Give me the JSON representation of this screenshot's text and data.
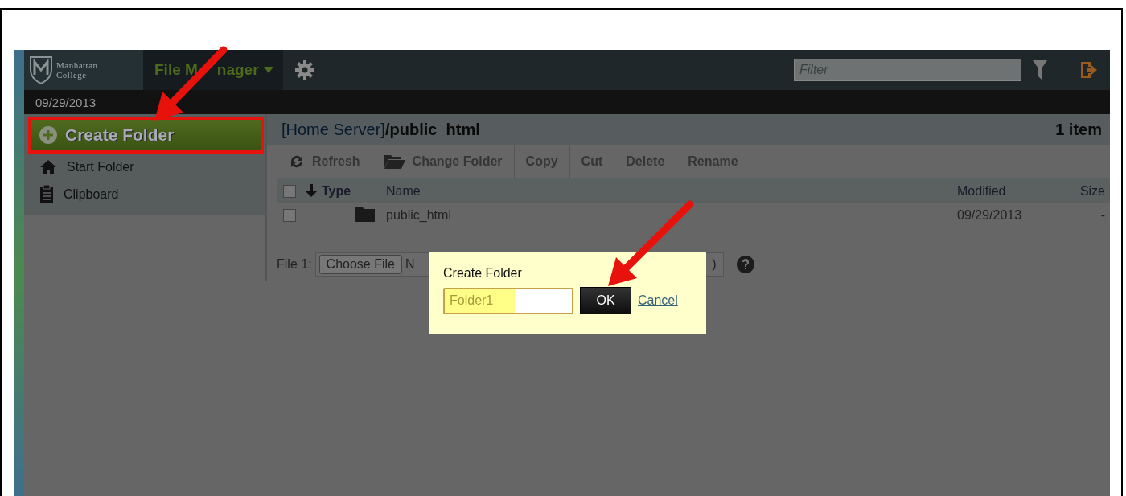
{
  "header": {
    "logo_lines": [
      "Manhattan",
      "College"
    ],
    "app_menu_parts": [
      "File M",
      "nager"
    ],
    "filter": {
      "placeholder": "Filter"
    }
  },
  "date": "09/29/2013",
  "sidebar": {
    "create_button": "Create Folder",
    "items": [
      {
        "kind": "home",
        "label": "Start Folder"
      },
      {
        "kind": "clipboard",
        "label": "Clipboard"
      }
    ]
  },
  "path": {
    "server": "[Home Server]",
    "folder": "/public_html",
    "count": "1 item"
  },
  "toolbar": [
    {
      "kind": "refresh",
      "label": "Refresh"
    },
    {
      "kind": "folder",
      "label": "Change Folder"
    },
    {
      "kind": "plain",
      "label": "Copy"
    },
    {
      "kind": "plain",
      "label": "Cut"
    },
    {
      "kind": "plain",
      "label": "Delete"
    },
    {
      "kind": "plain",
      "label": "Rename"
    }
  ],
  "table": {
    "columns": [
      "Type",
      "Name",
      "Modified",
      "Size"
    ],
    "rows": [
      {
        "checked": false,
        "name": "public_html",
        "modified": "09/29/2013",
        "size": "-"
      }
    ],
    "all_checked": false
  },
  "upload": {
    "label": "File 1:",
    "button": "Choose File",
    "status_start": "N",
    "tail": ")"
  },
  "dialog": {
    "title": "Create Folder",
    "value": "Folder1",
    "ok": "OK",
    "cancel": "Cancel"
  }
}
